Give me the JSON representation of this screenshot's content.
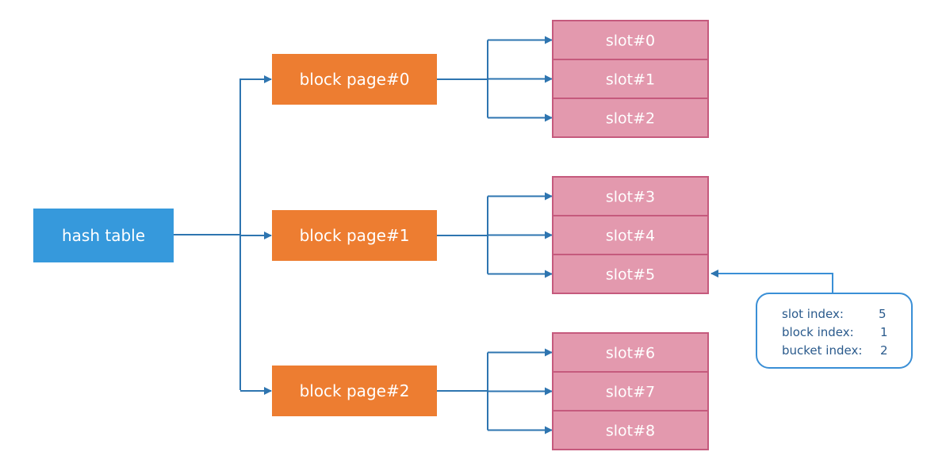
{
  "diagram": {
    "colors": {
      "hash_table_fill": "#3699dc",
      "block_fill": "#ed7d31",
      "slot_fill": "#e399ae",
      "slot_stroke": "#c55a7d",
      "arrow": "#2e75b0",
      "callout_stroke": "#3a8fd6",
      "callout_text": "#2a5a8c"
    },
    "hash_table": {
      "label": "hash table"
    },
    "block_pages": [
      {
        "label": "block page#0",
        "slots": [
          "slot#0",
          "slot#1",
          "slot#2"
        ]
      },
      {
        "label": "block page#1",
        "slots": [
          "slot#3",
          "slot#4",
          "slot#5"
        ]
      },
      {
        "label": "block page#2",
        "slots": [
          "slot#6",
          "slot#7",
          "slot#8"
        ]
      }
    ],
    "callout": {
      "target_slot": "slot#5",
      "rows": [
        {
          "key": "slot index:",
          "value": "5"
        },
        {
          "key": "block index:",
          "value": "1"
        },
        {
          "key": "bucket index:",
          "value": "2"
        }
      ]
    }
  }
}
